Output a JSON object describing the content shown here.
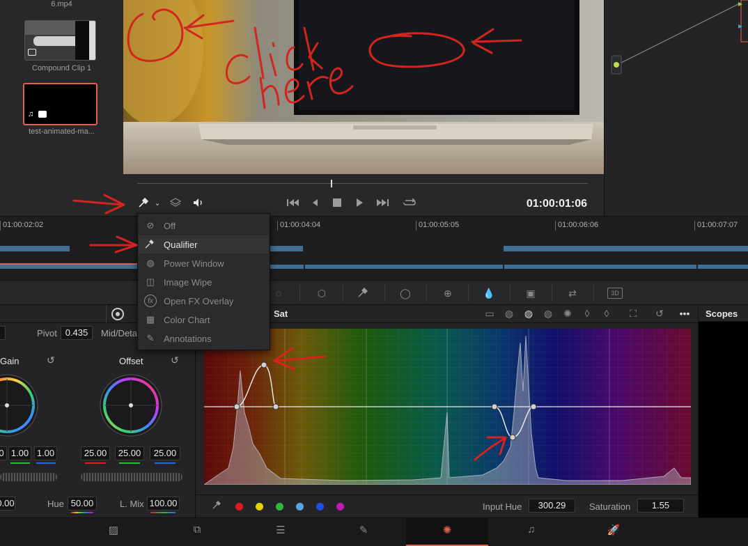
{
  "media_pool": {
    "clips": [
      {
        "name": "6.mp4"
      },
      {
        "name": "Compound Clip 1"
      },
      {
        "name": "test-animated-ma..."
      }
    ]
  },
  "viewer": {
    "timecode": "01:00:01:06",
    "scrub_position": 0.43
  },
  "timeline": {
    "timecodes": [
      "01:00:02:02",
      "01:00:04:04",
      "01:00:05:05",
      "01:00:06:06",
      "01:00:07:07"
    ]
  },
  "dropdown": {
    "items": [
      {
        "label": "Off",
        "icon": "off-icon"
      },
      {
        "label": "Qualifier",
        "icon": "eyedropper-icon"
      },
      {
        "label": "Power Window",
        "icon": "power-window-icon"
      },
      {
        "label": "Image Wipe",
        "icon": "image-wipe-icon"
      },
      {
        "label": "Open FX Overlay",
        "icon": "fx-icon"
      },
      {
        "label": "Color Chart",
        "icon": "color-chart-icon"
      },
      {
        "label": "Annotations",
        "icon": "annotations-icon"
      }
    ],
    "active": "Qualifier"
  },
  "primaries": {
    "pivot_label": "Pivot",
    "pivot_value": "0.435",
    "middetail_label": "Mid/Deta",
    "gain": {
      "label": "Gain",
      "values": [
        "0",
        "1.00",
        "1.00"
      ]
    },
    "offset": {
      "label": "Offset",
      "values": [
        "25.00",
        "25.00",
        "25.00"
      ]
    },
    "bottom": {
      "first_value": "0.00",
      "hue_label": "Hue",
      "hue_value": "50.00",
      "lmix_label": "L. Mix",
      "lmix_value": "100.00"
    }
  },
  "curves": {
    "title": "Sat",
    "input_hue_label": "Input Hue",
    "input_hue_value": "300.29",
    "saturation_label": "Saturation",
    "saturation_value": "1.55",
    "swatches": [
      "#e01b24",
      "#e5d200",
      "#2db83d",
      "#5ba3e0",
      "#1f4fe6",
      "#c21ab6"
    ]
  },
  "scopes": {
    "title": "Scopes"
  },
  "annotations": {
    "handwritten_text": "Click here"
  },
  "colors": {
    "annotation_red": "#d2251e",
    "accent_orange": "#e0624f",
    "track_blue": "#3f6f95"
  }
}
